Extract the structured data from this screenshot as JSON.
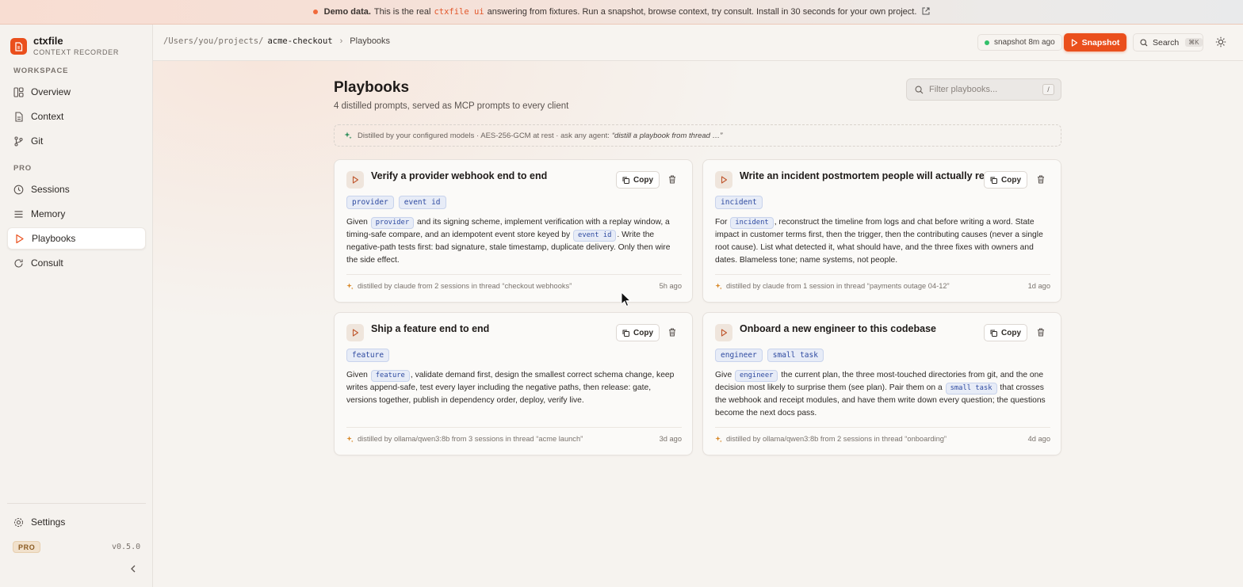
{
  "banner": {
    "strong": "Demo data.",
    "text1": "This is the real",
    "code": "ctxfile ui",
    "text2": "answering from fixtures. Run a snapshot, browse context, try consult. Install in 30 seconds for your own project."
  },
  "brand": {
    "name": "ctxfile",
    "sub": "CONTEXT RECORDER"
  },
  "sidebar": {
    "workspace_label": "WORKSPACE",
    "pro_label": "PRO",
    "workspace_items": [
      {
        "label": "Overview",
        "icon": "dashboard-icon"
      },
      {
        "label": "Context",
        "icon": "file-icon"
      },
      {
        "label": "Git",
        "icon": "git-branch-icon"
      }
    ],
    "pro_items": [
      {
        "label": "Sessions",
        "icon": "clock-icon"
      },
      {
        "label": "Memory",
        "icon": "list-icon"
      },
      {
        "label": "Playbooks",
        "icon": "play-icon",
        "active": true
      },
      {
        "label": "Consult",
        "icon": "refresh-icon"
      }
    ],
    "settings_label": "Settings",
    "badge": "PRO",
    "version": "v0.5.0"
  },
  "topbar": {
    "path": "/Users/you/projects/",
    "repo": "acme-checkout",
    "page": "Playbooks",
    "snapshot_status": "snapshot 8m ago",
    "snapshot_button": "Snapshot",
    "search_label": "Search",
    "search_kbd": "⌘K"
  },
  "page": {
    "title": "Playbooks",
    "subtitle": "4 distilled prompts, served as MCP prompts to every client",
    "filter_placeholder": "Filter playbooks...",
    "filter_kbd": "/",
    "info_text": "Distilled by your configured models · AES-256-GCM at rest · ask any agent:",
    "info_quote": "“distill a playbook from thread …”"
  },
  "cards": [
    {
      "title": "Verify a provider webhook end to end",
      "tags": [
        "provider",
        "event id"
      ],
      "body": [
        {
          "t": "Given "
        },
        {
          "tag": "provider"
        },
        {
          "t": " and its signing scheme, implement verification with a replay window, a timing-safe compare, and an idempotent event store keyed by "
        },
        {
          "tag": "event id"
        },
        {
          "t": ". Write the negative-path tests first: bad signature, stale timestamp, duplicate delivery. Only then wire the side effect."
        }
      ],
      "footer": "distilled by claude from 2 sessions in thread “checkout webhooks”",
      "age": "5h ago",
      "copy": "Copy"
    },
    {
      "title": "Write an incident postmortem people will actually read",
      "tags": [
        "incident"
      ],
      "body": [
        {
          "t": "For "
        },
        {
          "tag": "incident"
        },
        {
          "t": ", reconstruct the timeline from logs and chat before writing a word. State impact in customer terms first, then the trigger, then the contributing causes (never a single root cause). List what detected it, what should have, and the three fixes with owners and dates. Blameless tone; name systems, not people."
        }
      ],
      "footer": "distilled by claude from 1 session in thread “payments outage 04-12”",
      "age": "1d ago",
      "copy": "Copy"
    },
    {
      "title": "Ship a feature end to end",
      "tags": [
        "feature"
      ],
      "body": [
        {
          "t": "Given "
        },
        {
          "tag": "feature"
        },
        {
          "t": ", validate demand first, design the smallest correct schema change, keep writes append-safe, test every layer including the negative paths, then release: gate, versions together, publish in dependency order, deploy, verify live."
        }
      ],
      "footer": "distilled by ollama/qwen3:8b from 3 sessions in thread “acme launch”",
      "age": "3d ago",
      "copy": "Copy"
    },
    {
      "title": "Onboard a new engineer to this codebase",
      "tags": [
        "engineer",
        "small task"
      ],
      "body": [
        {
          "t": "Give "
        },
        {
          "tag": "engineer"
        },
        {
          "t": " the current plan, the three most-touched directories from git, and the one decision most likely to surprise them (see plan). Pair them on a "
        },
        {
          "tag": "small task"
        },
        {
          "t": " that crosses the webhook and receipt modules, and have them write down every question; the questions become the next docs pass."
        }
      ],
      "footer": "distilled by ollama/qwen3:8b from 2 sessions in thread “onboarding”",
      "age": "4d ago",
      "copy": "Copy"
    }
  ],
  "colors": {
    "accent": "#ea4f1c",
    "tag_bg": "#e7ecf7",
    "tag_fg": "#2e4aa0",
    "status_green": "#33c06a"
  }
}
